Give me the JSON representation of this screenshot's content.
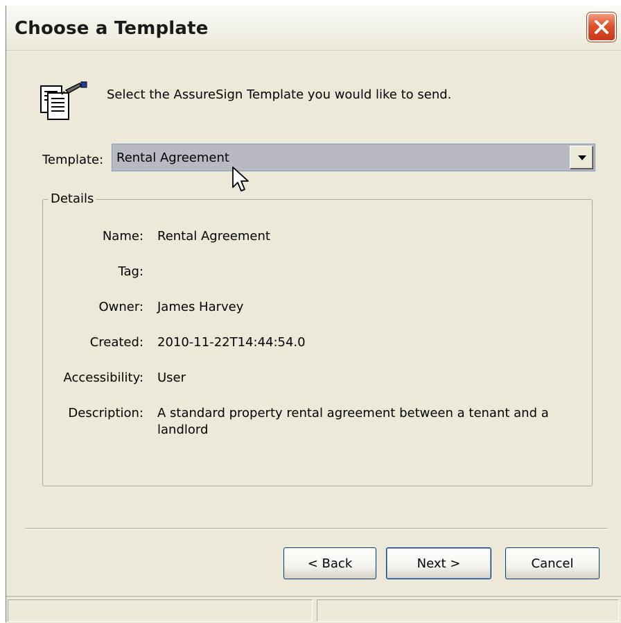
{
  "window": {
    "title": "Choose a Template"
  },
  "header": {
    "instruction": "Select the AssureSign Template you would like to send."
  },
  "template_picker": {
    "label": "Template:",
    "selected": "Rental Agreement"
  },
  "details": {
    "legend": "Details",
    "fields": [
      {
        "label": "Name:",
        "value": "Rental Agreement"
      },
      {
        "label": "Tag:",
        "value": ""
      },
      {
        "label": "Owner:",
        "value": "James Harvey"
      },
      {
        "label": "Created:",
        "value": "2010-11-22T14:44:54.0"
      },
      {
        "label": "Accessibility:",
        "value": "User"
      },
      {
        "label": "Description:",
        "value": "A standard property rental agreement between a tenant and a landlord"
      }
    ]
  },
  "buttons": {
    "back": "< Back",
    "next": "Next >",
    "cancel": "Cancel"
  },
  "status_bar": {
    "left": "",
    "right": ""
  },
  "icons": [
    "template-documents-icon",
    "close-icon",
    "dropdown-arrow-icon",
    "mouse-cursor-icon"
  ],
  "colors": {
    "close_button": "#d9462a",
    "select_highlight": "#b9b9c3",
    "face": "#ece9d8"
  }
}
